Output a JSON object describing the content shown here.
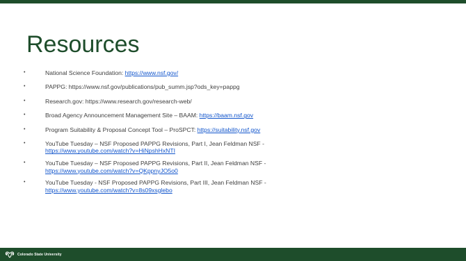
{
  "slide": {
    "title": "Resources",
    "items": [
      {
        "text": "National Science Foundation: ",
        "link": "https://www.nsf.gov/"
      },
      {
        "text": "PAPPG: https://www.nsf.gov/publications/pub_summ.jsp?ods_key=pappg",
        "link": ""
      },
      {
        "text": "Research.gov: https://www.research.gov/research-web/",
        "link": ""
      },
      {
        "text": "Broad Agency Announcement Management Site – BAAM: ",
        "link": "https://baam.nsf.gov"
      },
      {
        "text": "Program Suitability & Proposal Concept Tool – ProSPCT: ",
        "link": "https://suitability.nsf.gov"
      },
      {
        "text": "YouTube Tuesday – NSF Proposed PAPPG Revisions, Part I, Jean Feldman NSF - ",
        "link": "https://www.youtube.com/watch?v=HiNpshHxNTI"
      },
      {
        "text": "YouTube Tuesday – NSF Proposed PAPPG Revisions, Part II, Jean Feldman NSF - ",
        "link": "https://www.youtube.com/watch?v=QKppnyJO5o0"
      },
      {
        "text": "YouTube Tuesday - NSF Proposed PAPPG Revisions, Part III, Jean Feldman NSF - ",
        "link": "https://www.youtube.com/watch?v=8s09xsglebo"
      }
    ],
    "bullet_char": "•"
  },
  "footer": {
    "logo_text": "Colorado State University",
    "logo_icon": "csu-ram-logo-icon"
  },
  "colors": {
    "brand_green": "#1e4d2b",
    "body_text": "#404040",
    "link": "#1155cc"
  }
}
